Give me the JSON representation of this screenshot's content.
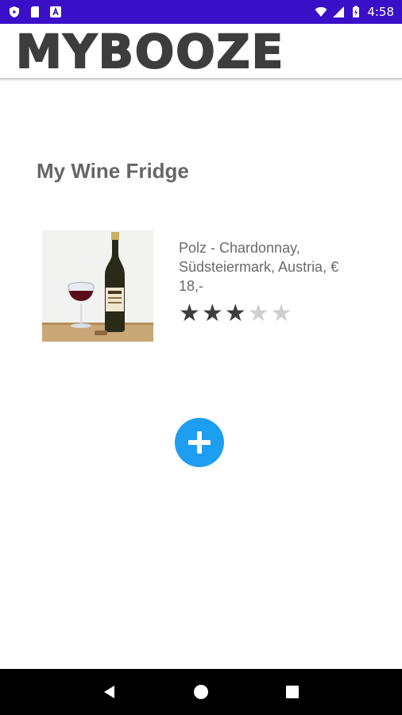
{
  "status_bar": {
    "time": "4:58",
    "icons": [
      "shield-play-icon",
      "sim-card-icon",
      "accessibility-a-icon",
      "wifi-icon",
      "signal-icon",
      "battery-charging-icon"
    ]
  },
  "app_bar": {
    "title": "MYBOOZE"
  },
  "page": {
    "title": "My Wine Fridge"
  },
  "wines": [
    {
      "description": "Polz - Chardonnay, Südsteiermark, Austria, € 18,-",
      "rating": 3,
      "rating_max": 5,
      "image": "wine-bottle-and-glass"
    }
  ],
  "fab": {
    "icon": "plus-icon"
  },
  "nav_bar": {
    "icons": [
      "back-icon",
      "home-icon",
      "recents-icon"
    ]
  },
  "colors": {
    "status_bar": "#3a0fc8",
    "fab": "#1e9ef0",
    "star_on": "#3d3d3d",
    "star_off": "#cfcfcf",
    "text": "#666666"
  }
}
